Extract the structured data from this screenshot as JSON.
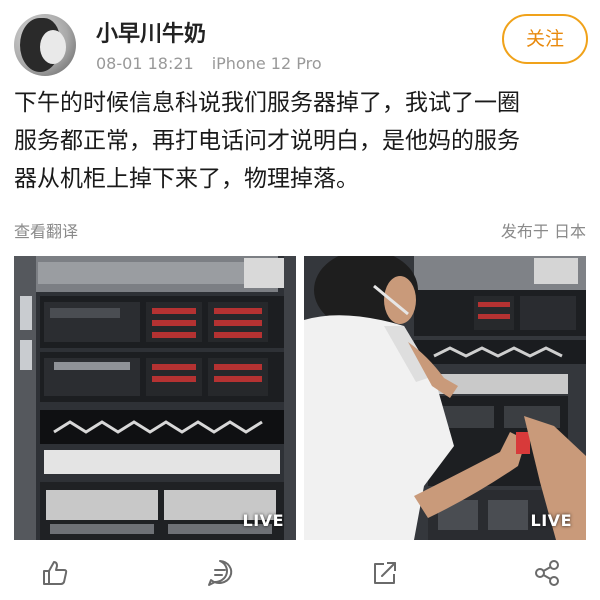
{
  "header": {
    "username": "小早川牛奶",
    "date": "08-01 18:21",
    "device": "iPhone 12 Pro",
    "follow_label": "关注"
  },
  "post": {
    "lines": [
      "下午的时候信息科说我们服务器掉了，我试了一圈",
      "服务都正常，再打电话问才说明白，是他妈的服务",
      "器从机柜上掉下来了，物理掉落。"
    ],
    "translate_label": "查看翻译",
    "published_label": "发布于 日本"
  },
  "photos": [
    {
      "badge": "LIVE",
      "icon": "live-photo"
    },
    {
      "badge": "LIVE",
      "icon": "live-photo"
    }
  ],
  "actions": [
    {
      "icon": "like-icon"
    },
    {
      "icon": "comment-icon"
    },
    {
      "icon": "repost-icon"
    },
    {
      "icon": "share-icon"
    }
  ],
  "colors": {
    "accent": "#f0a21a",
    "muted_text": "#999999",
    "body_text": "#1a1a1a"
  }
}
